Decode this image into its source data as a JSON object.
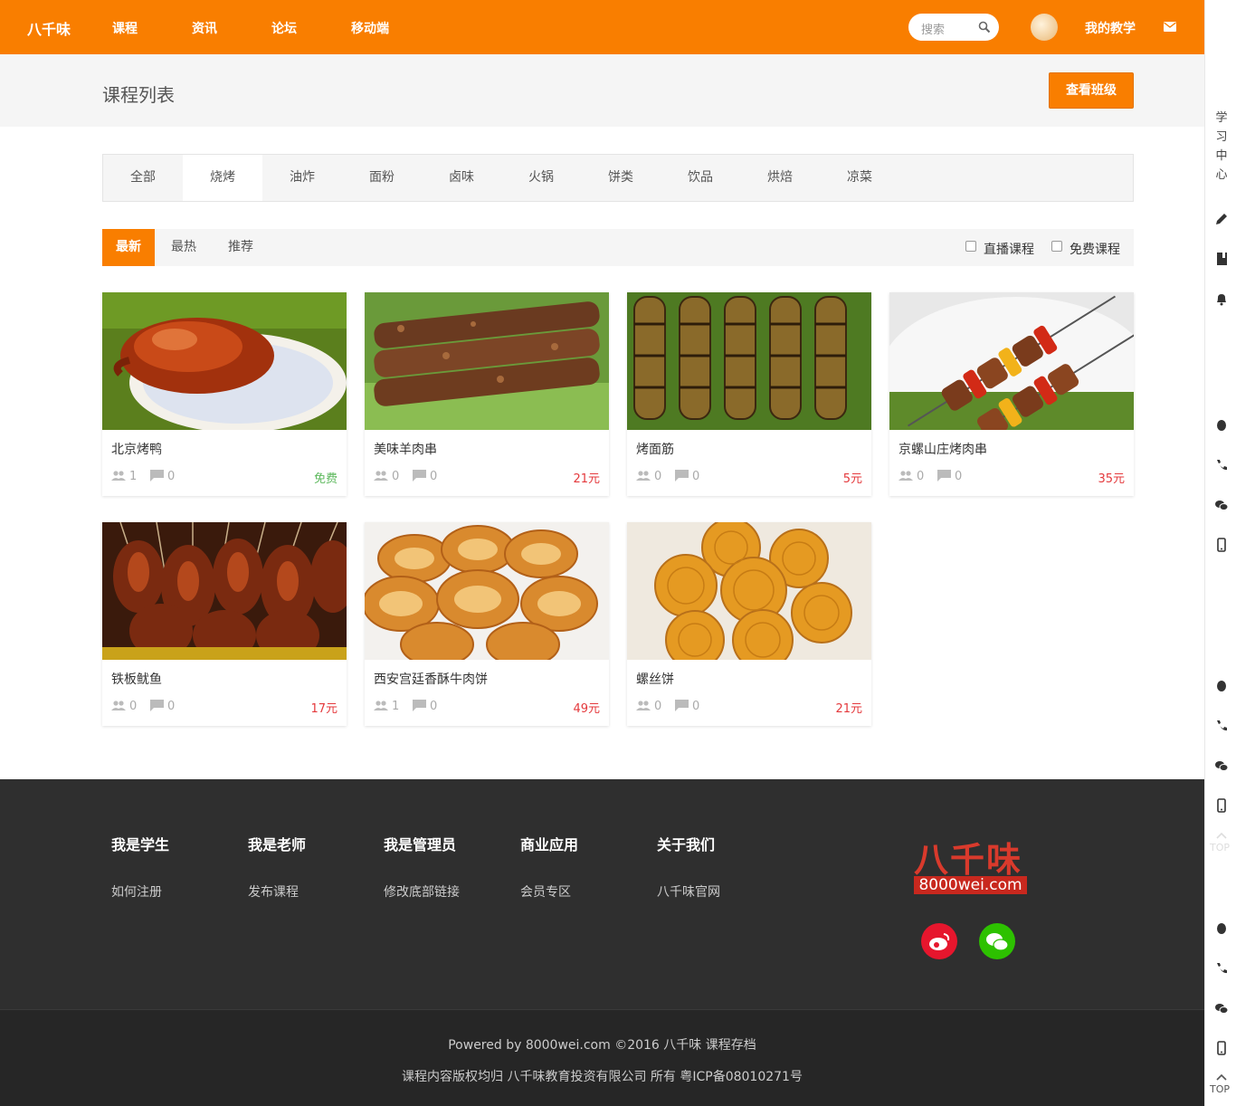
{
  "nav": {
    "logo": "八千味",
    "links": [
      "课程",
      "资讯",
      "论坛",
      "移动端"
    ],
    "search_placeholder": "搜索",
    "my_teaching": "我的教学"
  },
  "header": {
    "title": "课程列表",
    "view_class_button": "查看班级"
  },
  "categories": [
    "全部",
    "烧烤",
    "油炸",
    "面粉",
    "卤味",
    "火锅",
    "饼类",
    "饮品",
    "烘焙",
    "凉菜"
  ],
  "active_category": "烧烤",
  "sort": {
    "options": [
      "最新",
      "最热",
      "推荐"
    ],
    "active": "最新",
    "filters": [
      "直播课程",
      "免费课程"
    ]
  },
  "courses": [
    {
      "title": "北京烤鸭",
      "students": "1",
      "comments": "0",
      "price": "免费",
      "image": "roast-duck"
    },
    {
      "title": "美味羊肉串",
      "students": "0",
      "comments": "0",
      "price": "21元",
      "image": "lamb-skewers"
    },
    {
      "title": "烤面筋",
      "students": "0",
      "comments": "0",
      "price": "5元",
      "image": "gluten-skewers"
    },
    {
      "title": "京螺山庄烤肉串",
      "students": "0",
      "comments": "0",
      "price": "35元",
      "image": "meat-pepper-skewers"
    },
    {
      "title": "铁板鱿鱼",
      "students": "0",
      "comments": "0",
      "price": "17元",
      "image": "squid-skewers"
    },
    {
      "title": "西安宫廷香酥牛肉饼",
      "students": "1",
      "comments": "0",
      "price": "49元",
      "image": "beef-pastry"
    },
    {
      "title": "螺丝饼",
      "students": "0",
      "comments": "0",
      "price": "21元",
      "image": "spiral-cakes"
    }
  ],
  "footer": {
    "columns": [
      {
        "title": "我是学生",
        "link": "如何注册"
      },
      {
        "title": "我是老师",
        "link": "发布课程"
      },
      {
        "title": "我是管理员",
        "link": "修改底部链接"
      },
      {
        "title": "商业应用",
        "link": "会员专区"
      },
      {
        "title": "关于我们",
        "link": "八千味官网"
      }
    ],
    "logo_text": "八千味",
    "logo_domain": "8000wei.com",
    "line1": "Powered by 8000wei.com ©2016   八千味   课程存档",
    "line2": "课程内容版权均归 八千味教育投资有限公司 所有   粤ICP备08010271号"
  },
  "sidebar": {
    "learning_center": "学习中心",
    "top_label": "TOP"
  },
  "colors": {
    "brand": "#f97e00",
    "price": "#e4393c",
    "free": "#5cb85c",
    "weibo": "#e6162d",
    "wechat": "#2dc100"
  }
}
